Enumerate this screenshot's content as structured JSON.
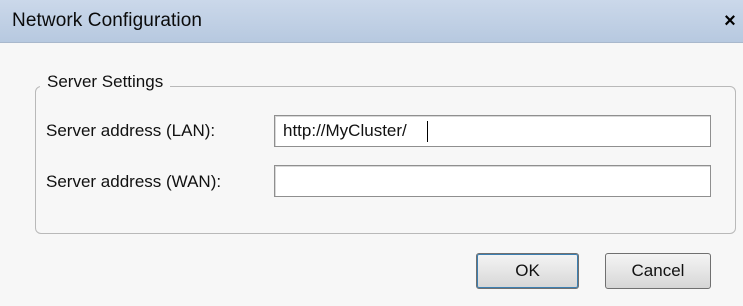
{
  "window": {
    "title": "Network Configuration",
    "close_glyph": "✕",
    "close_icon": "close-icon"
  },
  "server_settings": {
    "group_title": "Server Settings",
    "lan": {
      "label": "Server address (LAN):",
      "value": "http://MyCluster/"
    },
    "wan": {
      "label": "Server address (WAN):",
      "value": ""
    }
  },
  "buttons": {
    "ok_label": "OK",
    "cancel_label": "Cancel"
  },
  "colors": {
    "titlebar": "#b7c9e0",
    "dialog_bg": "#f7f7f7",
    "focus_border": "#3c7fb1"
  }
}
